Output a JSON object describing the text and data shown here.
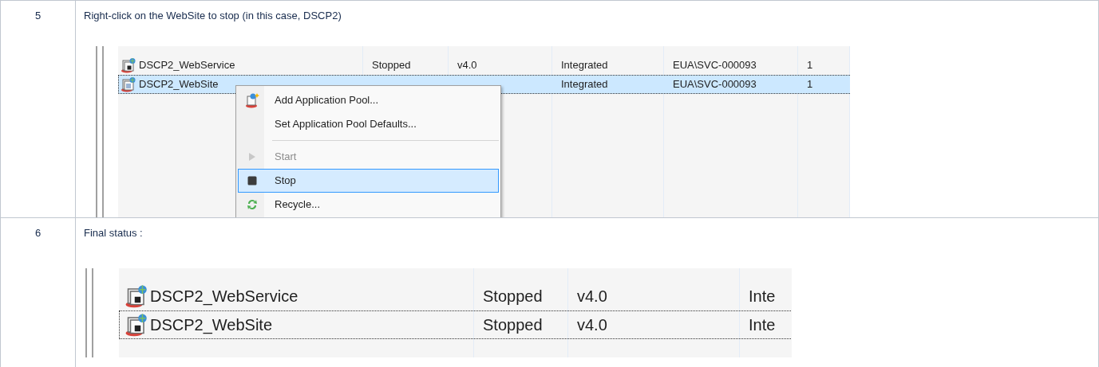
{
  "steps": [
    {
      "number": "5",
      "instruction": "Right-click on the WebSite to stop (in this case, DSCP2)",
      "screenshot": {
        "kind": "menu",
        "rows": [
          {
            "name": "DSCP2_WebService",
            "status": "Stopped",
            "version": "v4.0",
            "pipeline": "Integrated",
            "identity": "EUA\\SVC-000093",
            "apps": "1",
            "selected": false,
            "focused": false
          },
          {
            "name": "DSCP2_WebSite",
            "status": "",
            "version": "",
            "pipeline": "Integrated",
            "identity": "EUA\\SVC-000093",
            "apps": "1",
            "selected": true,
            "focused": true
          }
        ],
        "menu": [
          {
            "kind": "item",
            "label": "Add Application Pool...",
            "disabled": false,
            "selected": false
          },
          {
            "kind": "item",
            "label": "Set Application Pool Defaults...",
            "disabled": false,
            "selected": false
          },
          {
            "kind": "separator"
          },
          {
            "kind": "item",
            "label": "Start",
            "disabled": true,
            "selected": false
          },
          {
            "kind": "item",
            "label": "Stop",
            "disabled": false,
            "selected": true
          },
          {
            "kind": "item",
            "label": "Recycle...",
            "disabled": false,
            "selected": false
          }
        ]
      }
    },
    {
      "number": "6",
      "instruction": "Final status :",
      "screenshot": {
        "kind": "zoomed",
        "rows": [
          {
            "name": "DSCP2_WebService",
            "status": "Stopped",
            "version": "v4.0",
            "pipeline": "Inte",
            "selected": false,
            "focused": false
          },
          {
            "name": "DSCP2_WebSite",
            "status": "Stopped",
            "version": "v4.0",
            "pipeline": "Inte",
            "selected": false,
            "focused": true
          }
        ]
      }
    }
  ]
}
